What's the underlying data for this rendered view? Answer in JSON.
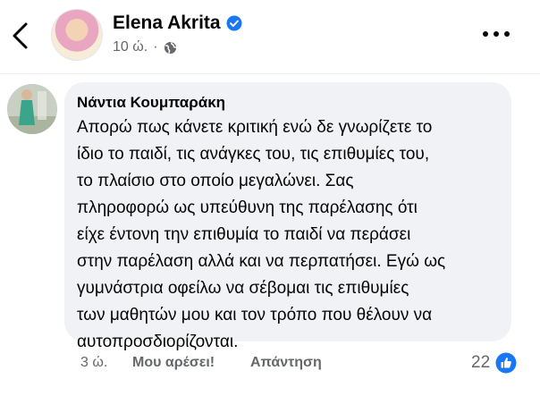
{
  "post": {
    "author": "Elena Akrita",
    "time": "10 ώ.",
    "separator": "·",
    "icons": {
      "back": "chevron-left-icon",
      "verified": "verified-badge-icon",
      "audience": "globe-icon",
      "more": "more-dots-icon"
    },
    "colors": {
      "verified": "#1877f2"
    }
  },
  "comment": {
    "author": "Νάντια Κουμπαράκη",
    "lines": [
      "Απορώ πως κάνετε κριτική ενώ δε γνωρίζετε το",
      "ίδιο το παιδί, τις ανάγκες του, τις επιθυμίες του,",
      "το πλαίσιο στο οποίο μεγαλώνει. Σας",
      "πληροφορώ ως υπεύθυνη της παρέλασης ότι",
      "είχε έντονη την επιθυμία το παιδί να περάσει",
      "στην παρέλαση αλλά και να περπατήσει. Εγώ ως",
      "γυμνάστρια οφείλω να σέβομαι τις επιθυμίες",
      "των μαθητών μου και τον τρόπο που θέλουν να",
      "αυτοπροσδιορίζονται."
    ],
    "time": "3 ώ.",
    "like_label": "Μου αρέσει!",
    "reply_label": "Απάντηση",
    "reaction_count": "22",
    "icons": {
      "reaction": "thumbs-up-icon"
    },
    "colors": {
      "bubble": "#f0f2f5",
      "reaction": "#1877f2"
    }
  }
}
